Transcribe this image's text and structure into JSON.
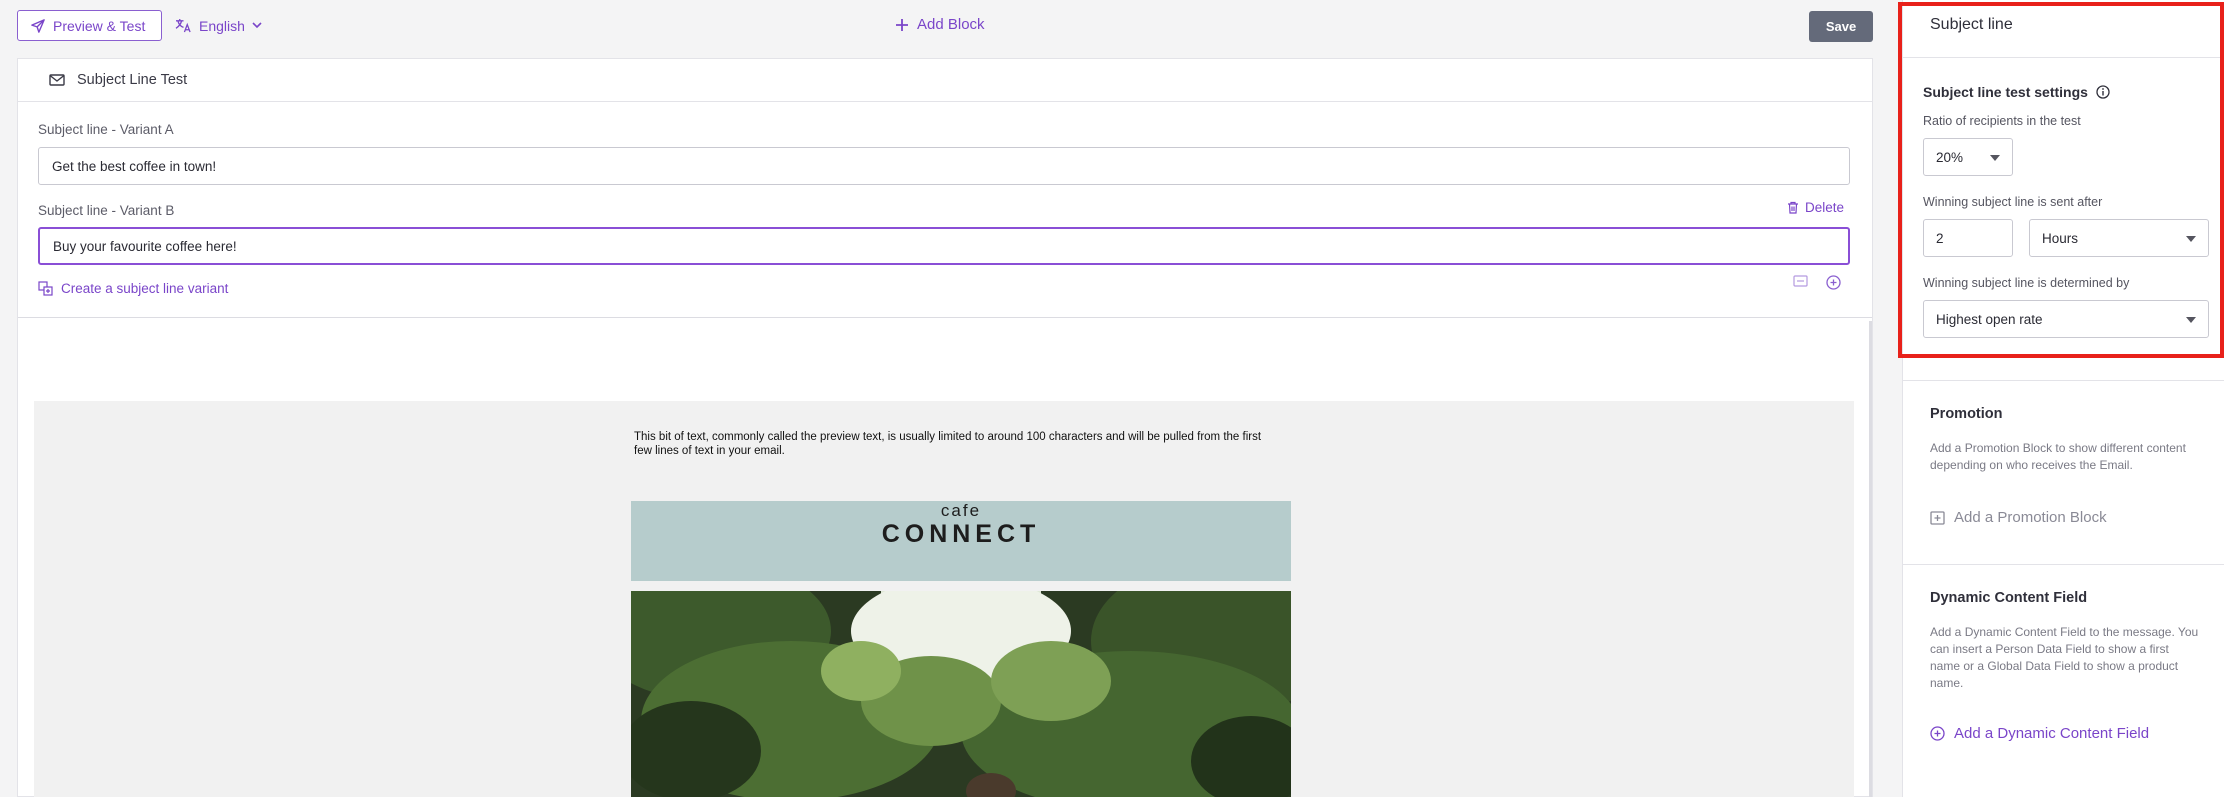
{
  "toolbar": {
    "preview_label": "Preview & Test",
    "language_label": "English",
    "add_block_label": "Add Block",
    "save_label": "Save"
  },
  "editor": {
    "header_title": "Subject Line Test",
    "variant_a_label": "Subject line - Variant A",
    "variant_a_value": "Get the best coffee in town!",
    "variant_b_label": "Subject line - Variant B",
    "variant_b_value": "Buy your favourite coffee here!",
    "delete_label": "Delete",
    "create_variant_label": "Create a subject line variant"
  },
  "email": {
    "preheader": "This bit of text, commonly called the preview text, is usually limited to around 100 characters and will be pulled from the first few lines of text in your email.",
    "brand_small": "cafe",
    "brand_big": "CONNECT"
  },
  "panel": {
    "title": "Subject line",
    "settings_heading": "Subject line test settings",
    "ratio_label": "Ratio of recipients in the test",
    "ratio_value": "20%",
    "sent_after_label": "Winning subject line is sent after",
    "sent_after_number": "2",
    "sent_after_unit": "Hours",
    "determined_by_label": "Winning subject line is determined by",
    "determined_by_value": "Highest open rate",
    "promotion": {
      "title": "Promotion",
      "description": "Add a Promotion Block to show different content depending on who receives the Email.",
      "action": "Add a Promotion Block"
    },
    "dynamic": {
      "title": "Dynamic Content Field",
      "description": "Add a Dynamic Content Field to the message. You can insert a Person Data Field to show a first name or a Global Data Field to show a product name.",
      "action": "Add a Dynamic Content Field"
    }
  },
  "colors": {
    "accent": "#7a45c9",
    "save_button": "#646a7a",
    "highlight": "#e8211a",
    "brand_banner": "#b6cccc"
  }
}
